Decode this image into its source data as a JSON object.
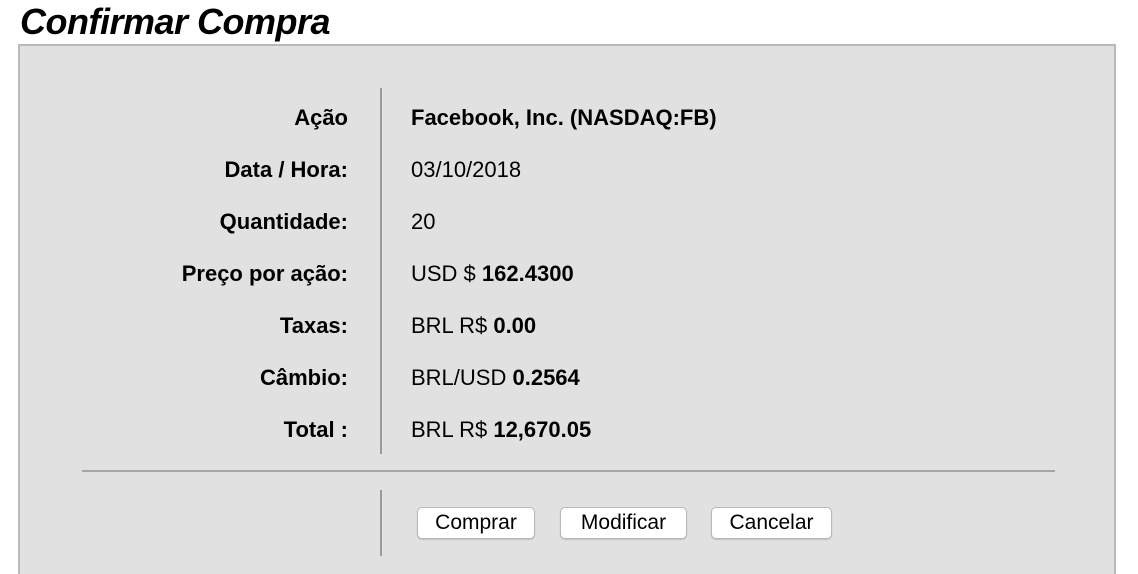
{
  "page": {
    "title": "Confirmar Compra"
  },
  "details": [
    {
      "label": "Ação",
      "value_prefix": "",
      "value_bold": "Facebook, Inc. (NASDAQ:FB)"
    },
    {
      "label": "Data / Hora:",
      "value_prefix": "03/10/2018",
      "value_bold": ""
    },
    {
      "label": "Quantidade:",
      "value_prefix": "20",
      "value_bold": ""
    },
    {
      "label": "Preço por ação:",
      "value_prefix": "USD $ ",
      "value_bold": "162.4300"
    },
    {
      "label": "Taxas:",
      "value_prefix": "BRL R$ ",
      "value_bold": "0.00"
    },
    {
      "label": "Câmbio:",
      "value_prefix": "BRL/USD ",
      "value_bold": "0.2564"
    },
    {
      "label": "Total :",
      "value_prefix": "BRL R$ ",
      "value_bold": "12,670.05"
    }
  ],
  "actions": {
    "buy_label": "Comprar",
    "modify_label": "Modificar",
    "cancel_label": "Cancelar"
  },
  "colors": {
    "panel_background": "#e1e1e1",
    "panel_border": "#b9b9b9",
    "button_background": "#ffffff"
  }
}
